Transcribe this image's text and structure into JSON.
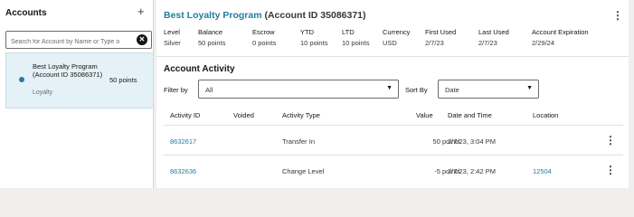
{
  "accounts_panel": {
    "title": "Accounts",
    "add_icon": "plus-icon",
    "search_placeholder": "Search for Account by Name or Type o",
    "clear_icon": "close-circle-icon",
    "items": [
      {
        "name": "Best Loyalty Program (Account ID 35086371)",
        "type": "Loyalty",
        "points": "50 points",
        "selected": true
      }
    ]
  },
  "account_detail": {
    "program_name": "Best Loyalty Program",
    "account_id_label": "(Account ID 35086371)",
    "more_icon": "kebab-menu-icon",
    "summary": [
      {
        "label": "Level",
        "value": "Silver"
      },
      {
        "label": "Balance",
        "value": "50 points"
      },
      {
        "label": "Escrow",
        "value": "0 points"
      },
      {
        "label": "YTD",
        "value": "10 points"
      },
      {
        "label": "LTD",
        "value": "10 points"
      },
      {
        "label": "Currency",
        "value": "USD"
      },
      {
        "label": "First Used",
        "value": "2/7/23"
      },
      {
        "label": "Last Used",
        "value": "2/7/23"
      },
      {
        "label": "Account Expiration",
        "value": "2/29/24"
      }
    ]
  },
  "activity": {
    "title": "Account Activity",
    "filter_label": "Filter by",
    "filter_value": "All",
    "sort_label": "Sort By",
    "sort_value": "Date",
    "columns": [
      "Activity ID",
      "Voided",
      "Activity Type",
      "Value",
      "Date and Time",
      "Location"
    ],
    "rows": [
      {
        "activity_id": "8632617",
        "voided": "",
        "activity_type": "Transfer In",
        "value": "50 points",
        "date_time": "2/7/23, 3:04 PM",
        "location": ""
      },
      {
        "activity_id": "8632636",
        "voided": "",
        "activity_type": "Change Level",
        "value": "-5 points",
        "date_time": "2/7/23, 2:42 PM",
        "location": "12504"
      }
    ]
  },
  "colors": {
    "accent": "#227e9e",
    "selected_bg": "#e4f1f7",
    "page_bg": "#f1efed"
  }
}
